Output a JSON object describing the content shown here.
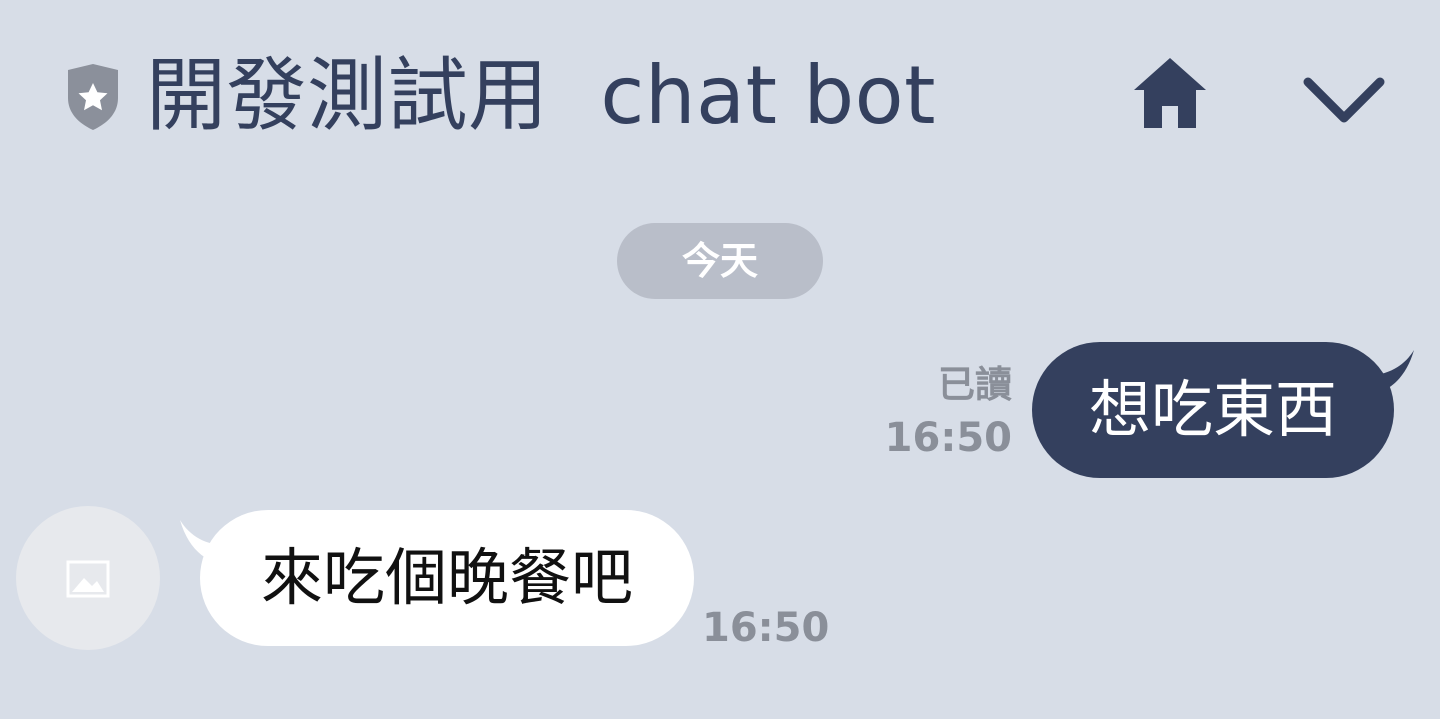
{
  "header": {
    "title": "開發測試用  chat bot",
    "icons": {
      "badge": "shield-star-icon",
      "home": "home-icon",
      "expand": "chevron-down-icon"
    }
  },
  "date_separator": "今天",
  "messages": [
    {
      "direction": "outgoing",
      "text": "想吃東西",
      "read_status": "已讀",
      "time": "16:50"
    },
    {
      "direction": "incoming",
      "text": "來吃個晚餐吧",
      "time": "16:50",
      "avatar_icon": "image-placeholder-icon"
    }
  ],
  "colors": {
    "background": "#d7dde7",
    "accent": "#34405e",
    "date_pill": "#b9bec9",
    "meta_text": "#8a8f99",
    "incoming_bubble": "#ffffff"
  }
}
